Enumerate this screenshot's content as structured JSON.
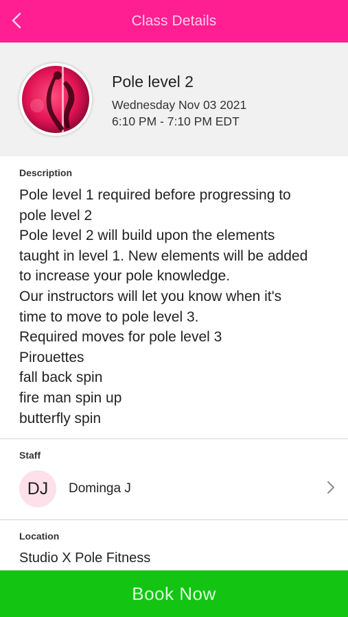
{
  "header": {
    "title": "Class Details",
    "back_icon": "chevron-left-icon",
    "background_color": "#ff1f93"
  },
  "class": {
    "name": "Pole level 2",
    "date": "Wednesday Nov 03 2021",
    "time": "6:10 PM - 7:10 PM EDT"
  },
  "description": {
    "label": "Description",
    "lines": [
      "Pole level 1 required before progressing to",
      "pole level 2",
      "Pole level 2 will build upon the elements",
      "taught in level 1. New elements will be added",
      "to increase your pole knowledge.",
      "Our instructors will let you know when it's",
      "time to move to pole level 3.",
      "Required moves for pole level 3",
      "Pirouettes",
      "fall back spin",
      "fire man spin up",
      "butterfly spin"
    ]
  },
  "staff": {
    "label": "Staff",
    "initials": "DJ",
    "name": "Dominga J",
    "chevron_icon": "chevron-right-icon"
  },
  "location": {
    "label": "Location",
    "name": "Studio X Pole Fitness"
  },
  "book": {
    "label": "Book Now",
    "color": "#13c413"
  }
}
